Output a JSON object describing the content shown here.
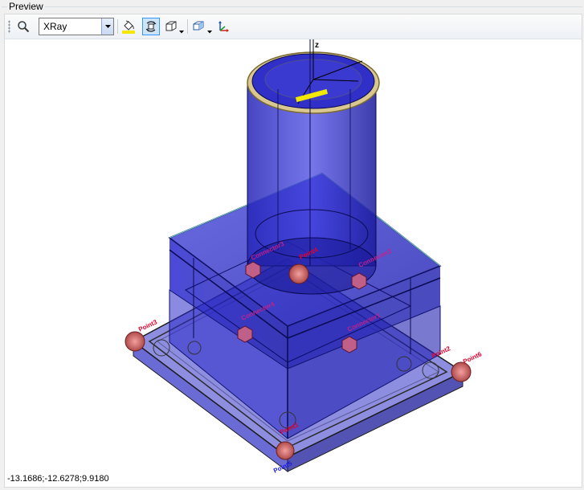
{
  "group": {
    "title": "Preview"
  },
  "toolbar": {
    "zoom_icon": "magnifier-icon",
    "render_mode": {
      "value": "XRay"
    },
    "fill_icon": "paint-bucket-icon",
    "rotate_icon": "rotate-view-icon",
    "box_icon": "bounding-box-icon",
    "views_icon": "view-cube-icon",
    "axes_icon": "axes-icon"
  },
  "viewport": {
    "labels": {
      "connector1": "Connector1",
      "connector2": "Connector2",
      "connector3": "Connector3",
      "connector4": "Connector4",
      "point1": "Point1",
      "point2": "Point2",
      "point3": "Point3",
      "point4": "Point4",
      "point5": "Point5",
      "point6": "Point6",
      "axis_z": "z"
    }
  },
  "status": {
    "coordinates": "-13.1686;-12.6278;9.9180"
  },
  "colors": {
    "body": "#2020c8",
    "body_dark": "#14147a",
    "plate_edge": "#2a2a2a",
    "marker": "#c0607a",
    "point_label": "#e8002a",
    "connector_label": "#c0228c",
    "accent_rim": "#c9b46a"
  }
}
